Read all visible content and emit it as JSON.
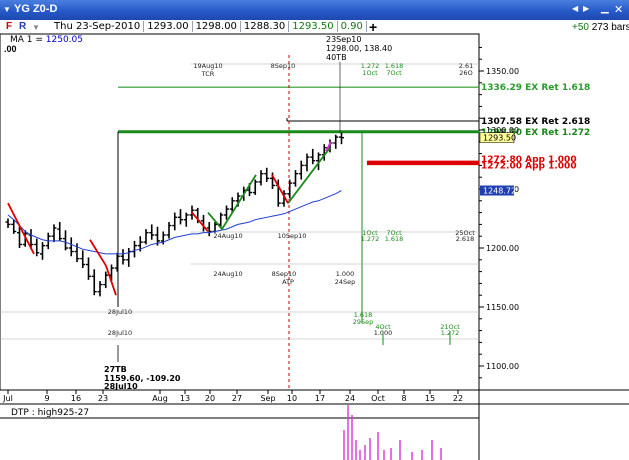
{
  "window": {
    "title": "YG Z0-D",
    "quote": {
      "date": "Thu 23-Sep-2010",
      "open": "1293.00",
      "high": "1298.00",
      "low": "1288.30",
      "close": "1293.50",
      "change": "0.90"
    },
    "toolbar": {
      "f": "F",
      "r": "R",
      "plus": "+"
    },
    "bars_change": "+50",
    "bars_count": "273 bars"
  },
  "indicator": {
    "ma_label": "MA 1 = ",
    "ma_value": "1250.05",
    "left_value": ".00"
  },
  "lower_panel": {
    "label": "DTP : high925-27"
  },
  "chart_data": {
    "type": "candlestick",
    "title": "YG Z0-D",
    "ylim": [
      1085,
      1380
    ],
    "y_ticks": [
      "1350.00",
      "1300.00",
      "1250.00",
      "1200.00",
      "1150.00",
      "1100.00"
    ],
    "x_ticks": [
      "Jul",
      "9",
      "16",
      "23",
      "Aug",
      "13",
      "20",
      "27",
      "Sep",
      "10",
      "17",
      "24",
      "Oct",
      "8",
      "15",
      "22"
    ],
    "price_tags": {
      "last": "1293.50",
      "ma": "1248.72"
    },
    "key_levels": [
      {
        "label": "1336.29 EX Ret 1.618",
        "value": 1336.29,
        "color": "#2c9a2c"
      },
      {
        "label": "1307.58 EX Ret 2.618",
        "value": 1307.58,
        "color": "#000000"
      },
      {
        "label": "1298.50 EX Ret 1.272",
        "value": 1298.5,
        "color": "#1a8a1a"
      },
      {
        "label": "1272.80 App 1.000",
        "value": 1272.8,
        "color": "#dd0000"
      },
      {
        "label": "1272.00 App 1.000",
        "value": 1271.5,
        "color": "#dd0000"
      }
    ],
    "annotations": {
      "top_pivot_name": "23Sep10",
      "top_pivot_values": "1298.00, 138.40",
      "top_pivot_tag": "40TB",
      "low_pivot_name": "27TB",
      "low_pivot_values": "1159.60, -109.20",
      "low_pivot_date": "28Jul10",
      "time_labels": [
        {
          "text": "19Aug10",
          "anchor": "mid"
        },
        {
          "text": "TCR",
          "anchor": "mid"
        },
        {
          "text": "8Sep10",
          "anchor": "mid"
        },
        {
          "text": "1.272",
          "anchor": "mid"
        },
        {
          "text": "1Oct",
          "anchor": "mid"
        },
        {
          "text": "1.618",
          "anchor": "mid"
        },
        {
          "text": "7Oct",
          "anchor": "mid"
        },
        {
          "text": "2.61",
          "anchor": "mid"
        },
        {
          "text": "26O",
          "anchor": "mid"
        },
        {
          "text": "24Aug10",
          "anchor": "mid"
        },
        {
          "text": "10Sep10",
          "anchor": "mid"
        },
        {
          "text": "1Oct",
          "anchor": "mid"
        },
        {
          "text": "1.272",
          "anchor": "mid"
        },
        {
          "text": "7Oct",
          "anchor": "mid"
        },
        {
          "text": "1.618",
          "anchor": "mid"
        },
        {
          "text": "25Oct",
          "anchor": "mid"
        },
        {
          "text": "2.618",
          "anchor": "mid"
        },
        {
          "text": "24Aug10",
          "anchor": "mid"
        },
        {
          "text": "8Sep10",
          "anchor": "mid"
        },
        {
          "text": "ATP",
          "anchor": "mid"
        },
        {
          "text": "1.000",
          "anchor": "mid"
        },
        {
          "text": "24Sep",
          "anchor": "mid"
        },
        {
          "text": "28Jul10",
          "anchor": "mid"
        },
        {
          "text": "28Jul10",
          "anchor": "mid"
        },
        {
          "text": "1.618",
          "anchor": "mid"
        },
        {
          "text": "29Sep",
          "anchor": "mid"
        },
        {
          "text": "4Oct",
          "anchor": "mid"
        },
        {
          "text": "1.000",
          "anchor": "mid"
        },
        {
          "text": "21Oct",
          "anchor": "mid"
        },
        {
          "text": "1.272",
          "anchor": "mid"
        }
      ]
    },
    "series": [
      {
        "name": "Price",
        "ohlc": [
          [
            1222,
            1225,
            1217,
            1220
          ],
          [
            1220,
            1224,
            1212,
            1214
          ],
          [
            1213,
            1218,
            1200,
            1203
          ],
          [
            1203,
            1215,
            1201,
            1212
          ],
          [
            1211,
            1216,
            1200,
            1203
          ],
          [
            1203,
            1208,
            1193,
            1196
          ],
          [
            1195,
            1205,
            1190,
            1202
          ],
          [
            1202,
            1213,
            1199,
            1210
          ],
          [
            1210,
            1220,
            1205,
            1217
          ],
          [
            1216,
            1222,
            1206,
            1208
          ],
          [
            1208,
            1215,
            1198,
            1200
          ],
          [
            1200,
            1209,
            1193,
            1197
          ],
          [
            1197,
            1204,
            1188,
            1191
          ],
          [
            1191,
            1198,
            1183,
            1186
          ],
          [
            1186,
            1192,
            1173,
            1176
          ],
          [
            1176,
            1182,
            1160,
            1163
          ],
          [
            1163,
            1172,
            1159,
            1169
          ],
          [
            1169,
            1180,
            1166,
            1177
          ],
          [
            1177,
            1186,
            1172,
            1183
          ],
          [
            1183,
            1196,
            1180,
            1193
          ],
          [
            1193,
            1199,
            1186,
            1190
          ],
          [
            1190,
            1200,
            1184,
            1197
          ],
          [
            1197,
            1206,
            1192,
            1202
          ],
          [
            1202,
            1210,
            1197,
            1205
          ],
          [
            1205,
            1216,
            1203,
            1213
          ],
          [
            1213,
            1220,
            1207,
            1211
          ],
          [
            1211,
            1218,
            1202,
            1206
          ],
          [
            1206,
            1214,
            1203,
            1211
          ],
          [
            1211,
            1222,
            1208,
            1219
          ],
          [
            1219,
            1230,
            1215,
            1226
          ],
          [
            1226,
            1233,
            1220,
            1224
          ],
          [
            1224,
            1230,
            1218,
            1228
          ],
          [
            1228,
            1236,
            1224,
            1232
          ],
          [
            1232,
            1234,
            1221,
            1223
          ],
          [
            1223,
            1228,
            1214,
            1217
          ],
          [
            1217,
            1222,
            1210,
            1214
          ],
          [
            1214,
            1222,
            1213,
            1220
          ],
          [
            1220,
            1230,
            1217,
            1228
          ],
          [
            1228,
            1236,
            1224,
            1233
          ],
          [
            1233,
            1243,
            1230,
            1240
          ],
          [
            1240,
            1247,
            1235,
            1244
          ],
          [
            1244,
            1252,
            1240,
            1249
          ],
          [
            1249,
            1255,
            1244,
            1247
          ],
          [
            1247,
            1258,
            1245,
            1256
          ],
          [
            1256,
            1266,
            1253,
            1263
          ],
          [
            1263,
            1268,
            1256,
            1259
          ],
          [
            1259,
            1264,
            1250,
            1253
          ],
          [
            1253,
            1258,
            1235,
            1238
          ],
          [
            1238,
            1249,
            1235,
            1246
          ],
          [
            1246,
            1258,
            1242,
            1255
          ],
          [
            1255,
            1266,
            1252,
            1263
          ],
          [
            1263,
            1274,
            1258,
            1270
          ],
          [
            1270,
            1280,
            1265,
            1277
          ],
          [
            1277,
            1284,
            1271,
            1274
          ],
          [
            1274,
            1281,
            1266,
            1279
          ],
          [
            1279,
            1288,
            1274,
            1285
          ],
          [
            1285,
            1292,
            1281,
            1289
          ],
          [
            1289,
            1296,
            1284,
            1294
          ],
          [
            1294,
            1298,
            1288,
            1293.5
          ]
        ]
      },
      {
        "name": "MA",
        "values": [
          1228,
          1224,
          1219,
          1214,
          1211,
          1209,
          1207,
          1206,
          1206,
          1206,
          1205,
          1203,
          1201,
          1199,
          1198,
          1197,
          1196,
          1195,
          1195,
          1195,
          1195,
          1196,
          1198,
          1199,
          1201,
          1203,
          1204,
          1205,
          1207,
          1209,
          1210,
          1211,
          1212,
          1212,
          1213,
          1213,
          1214,
          1215,
          1216,
          1218,
          1220,
          1221,
          1222,
          1224,
          1225,
          1226,
          1227,
          1228,
          1229,
          1231,
          1233,
          1235,
          1237,
          1239,
          1240,
          1242,
          1244,
          1246,
          1248.72
        ]
      },
      {
        "name": "DTP",
        "bars": [
          {
            "x": 344,
            "v": 30
          },
          {
            "x": 348,
            "v": 55
          },
          {
            "x": 352,
            "v": 45
          },
          {
            "x": 356,
            "v": 20
          },
          {
            "x": 360,
            "v": 10
          },
          {
            "x": 365,
            "v": 15
          },
          {
            "x": 370,
            "v": 22
          },
          {
            "x": 378,
            "v": 28
          },
          {
            "x": 384,
            "v": 10
          },
          {
            "x": 391,
            "v": 12
          },
          {
            "x": 400,
            "v": 20
          },
          {
            "x": 412,
            "v": 8
          },
          {
            "x": 422,
            "v": 10
          },
          {
            "x": 432,
            "v": 20
          },
          {
            "x": 441,
            "v": 12
          }
        ]
      }
    ]
  }
}
